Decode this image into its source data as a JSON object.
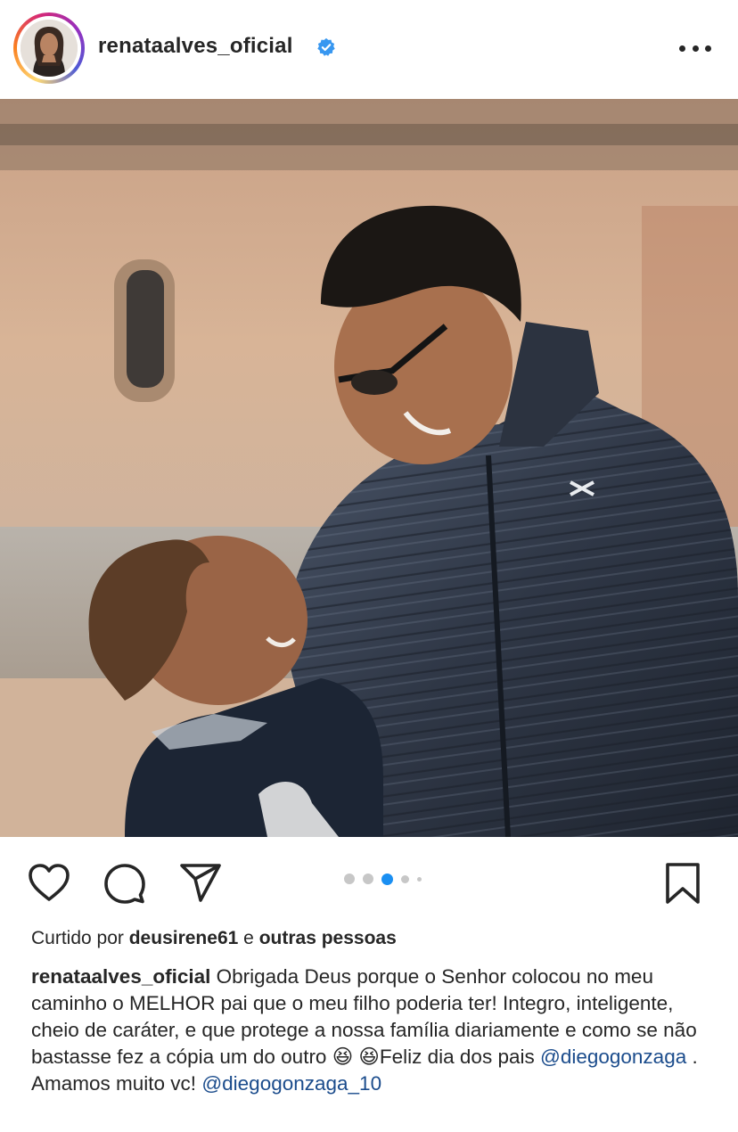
{
  "post": {
    "username": "renataalves_oficial",
    "verified": true,
    "icons": {
      "avatar": "profile-photo",
      "verified": "verified-badge-icon",
      "more": "more-options-icon",
      "like": "heart-icon",
      "comment": "comment-bubble-icon",
      "share": "send-paper-plane-icon",
      "save": "bookmark-icon"
    },
    "carousel": {
      "count": 5,
      "active_index": 3
    },
    "likes": {
      "prefix": "Curtido por",
      "user": "deusirene61",
      "joiner": "e",
      "others": "outras pessoas"
    },
    "caption": {
      "username": "renataalves_oficial",
      "text_1": "Obrigada Deus porque o Senhor colocou no meu caminho o MELHOR pai que o meu filho poderia ter! Integro, inteligente, cheio de caráter, e que protege a nossa família diariamente e como se não bastasse fez a cópia um do outro",
      "emoji": "😆 😆",
      "text_2": "Feliz dia dos pais",
      "mention_1": "@diegogonzaga",
      "text_3": ". Amamos muito vc!",
      "mention_2": "@diegogonzaga_10"
    },
    "colors": {
      "text": "#262626",
      "mention": "#1b4c8c",
      "verified_blue": "#3897f0",
      "dot_active": "#1a8ff2",
      "dot_inactive": "#c7c7c7"
    }
  }
}
